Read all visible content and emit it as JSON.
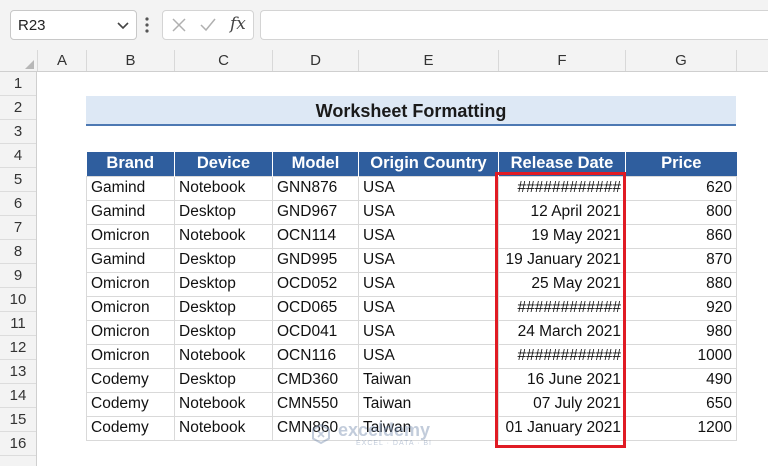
{
  "formula_bar": {
    "name_box": "R23",
    "fx_label": "fx",
    "formula": ""
  },
  "columns": [
    "A",
    "B",
    "C",
    "D",
    "E",
    "F",
    "G"
  ],
  "rows": [
    "1",
    "2",
    "3",
    "4",
    "5",
    "6",
    "7",
    "8",
    "9",
    "10",
    "11",
    "12",
    "13",
    "14",
    "15",
    "16"
  ],
  "title": "Worksheet Formatting",
  "table": {
    "headers": [
      "Brand",
      "Device",
      "Model",
      "Origin Country",
      "Release Date",
      "Price"
    ],
    "rows": [
      [
        "Gamind",
        "Notebook",
        "GNN876",
        "USA",
        "############",
        "620"
      ],
      [
        "Gamind",
        "Desktop",
        "GND967",
        "USA",
        "12 April 2021",
        "800"
      ],
      [
        "Omicron",
        "Notebook",
        "OCN114",
        "USA",
        "19 May 2021",
        "860"
      ],
      [
        "Gamind",
        "Desktop",
        "GND995",
        "USA",
        "19 January 2021",
        "870"
      ],
      [
        "Omicron",
        "Desktop",
        "OCD052",
        "USA",
        "25 May 2021",
        "880"
      ],
      [
        "Omicron",
        "Desktop",
        "OCD065",
        "USA",
        "############",
        "920"
      ],
      [
        "Omicron",
        "Desktop",
        "OCD041",
        "USA",
        "24 March 2021",
        "980"
      ],
      [
        "Omicron",
        "Notebook",
        "OCN116",
        "USA",
        "############",
        "1000"
      ],
      [
        "Codemy",
        "Desktop",
        "CMD360",
        "Taiwan",
        "16 June 2021",
        "490"
      ],
      [
        "Codemy",
        "Notebook",
        "CMN550",
        "Taiwan",
        "07 July 2021",
        "650"
      ],
      [
        "Codemy",
        "Notebook",
        "CMN860",
        "Taiwan",
        "01 January 2021",
        "1200"
      ]
    ]
  },
  "watermark": {
    "name": "exceldemy",
    "tagline": "EXCEL · DATA · BI"
  },
  "colors": {
    "header_fill": "#2f5e9e",
    "title_fill": "#dde8f5",
    "highlight": "#e01b24"
  }
}
